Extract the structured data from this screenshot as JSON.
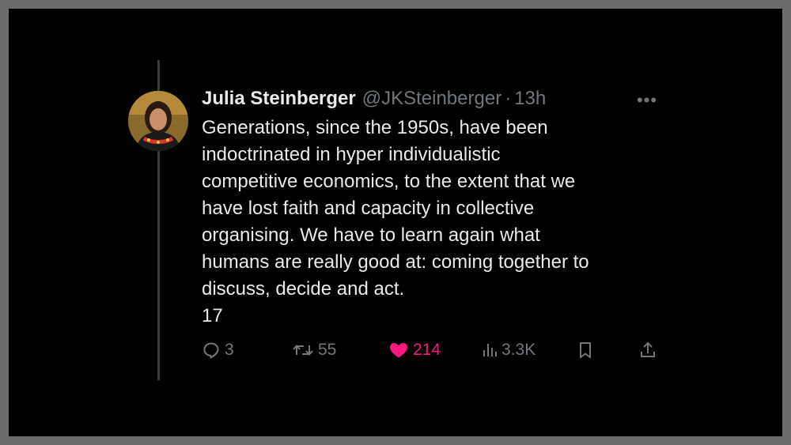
{
  "tweet": {
    "author_name": "Julia Steinberger",
    "handle": "@JKSteinberger",
    "separator": "·",
    "time": "13h",
    "more_label": "•••",
    "text_lines": [
      "Generations, since the 1950s, have been",
      "indoctrinated in hyper individualistic",
      "competitive economics, to the extent that we",
      "have lost faith and capacity in collective",
      "organising. We have to learn again what",
      "humans are really good at: coming together to",
      "discuss, decide and act."
    ],
    "trailing_number": "17"
  },
  "actions": {
    "reply": {
      "icon": "reply-icon",
      "count": "3"
    },
    "retweet": {
      "icon": "retweet-icon",
      "count": "55"
    },
    "like": {
      "icon": "heart-icon",
      "count": "214",
      "color": "#f91880"
    },
    "views": {
      "icon": "views-icon",
      "count": "3.3K"
    },
    "bookmark": {
      "icon": "bookmark-icon"
    },
    "share": {
      "icon": "share-icon"
    }
  },
  "colors": {
    "background": "#000000",
    "text": "#e7e9ea",
    "muted": "#71767b",
    "like": "#f91880",
    "outer_border": "#6b6b6b"
  }
}
